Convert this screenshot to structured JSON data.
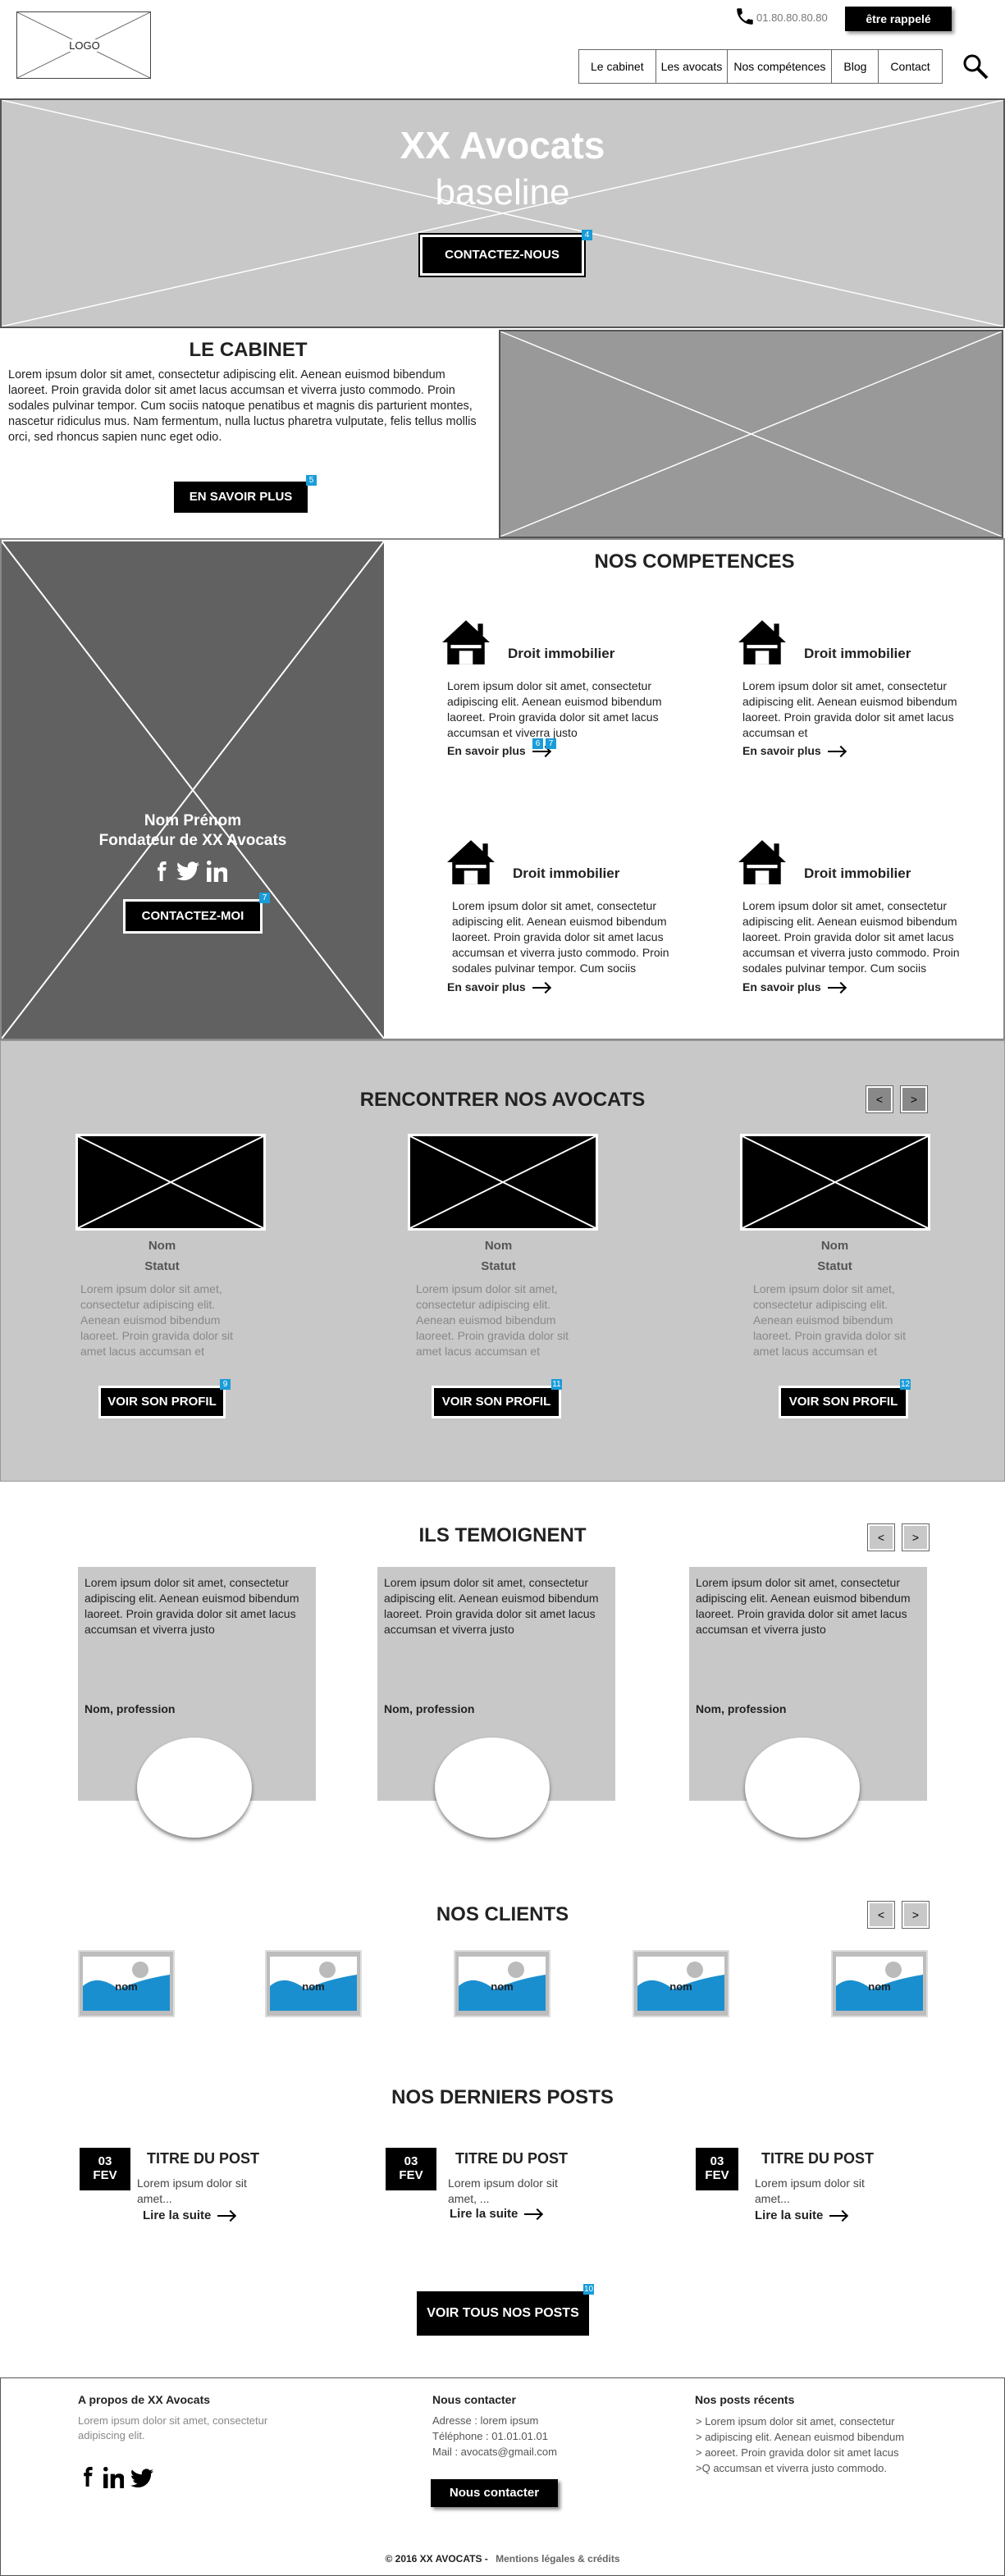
{
  "header": {
    "logo": "LOGO",
    "phone": "01.80.80.80.80",
    "callback_button": "être rappelé",
    "nav": [
      "Le cabinet",
      "Les avocats",
      "Nos compétences",
      "Blog",
      "Contact"
    ]
  },
  "hero": {
    "title": "XX Avocats",
    "baseline": "baseline",
    "cta": "CONTACTEZ-NOUS",
    "badge": "4"
  },
  "cabinet": {
    "title": "LE CABINET",
    "text": "Lorem ipsum dolor sit amet, consectetur adipiscing elit. Aenean euismod bibendum laoreet. Proin gravida dolor sit amet lacus accumsan et viverra justo commodo. Proin sodales pulvinar tempor. Cum sociis natoque penatibus et magnis dis parturient montes, nascetur ridiculus mus. Nam fermentum, nulla luctus pharetra vulputate, felis tellus mollis orci, sed rhoncus sapien nunc eget odio.",
    "button": "EN SAVOIR PLUS",
    "badge": "5"
  },
  "founder": {
    "name": "Nom Prénom",
    "role": "Fondateur de XX Avocats",
    "button": "CONTACTEZ-MOI",
    "badge": "7"
  },
  "competences": {
    "title": "NOS COMPETENCES",
    "items": [
      {
        "title": "Droit immobilier",
        "text": "Lorem ipsum dolor sit amet, consectetur adipiscing elit. Aenean euismod bibendum laoreet. Proin gravida dolor sit amet lacus accumsan et viverra justo",
        "link": "En savoir plus"
      },
      {
        "title": "Droit immobilier",
        "text": "Lorem ipsum dolor sit amet, consectetur adipiscing elit. Aenean euismod bibendum laoreet. Proin gravida dolor sit amet lacus accumsan et",
        "link": "En savoir plus"
      },
      {
        "title": "Droit immobilier",
        "text": "Lorem ipsum dolor sit amet, consectetur adipiscing elit. Aenean euismod bibendum laoreet. Proin gravida dolor sit amet lacus accumsan et viverra justo commodo. Proin sodales pulvinar tempor. Cum sociis",
        "link": "En savoir plus"
      },
      {
        "title": "Droit immobilier",
        "text": "Lorem ipsum dolor sit amet, consectetur adipiscing elit. Aenean euismod bibendum laoreet. Proin gravida dolor sit amet lacus accumsan et viverra justo commodo. Proin sodales pulvinar tempor. Cum sociis",
        "link": "En savoir plus"
      }
    ],
    "badges": [
      "6",
      "7"
    ]
  },
  "avocats": {
    "title": "RENCONTRER NOS AVOCATS",
    "prev": "<",
    "next": ">",
    "items": [
      {
        "name": "Nom",
        "status": "Statut",
        "text": "Lorem ipsum dolor sit amet, consectetur adipiscing elit. Aenean euismod bibendum laoreet. Proin gravida dolor sit amet lacus accumsan et",
        "button": "VOIR SON PROFIL",
        "badge": "9"
      },
      {
        "name": "Nom",
        "status": "Statut",
        "text": "Lorem ipsum dolor sit amet, consectetur adipiscing elit. Aenean euismod bibendum laoreet. Proin gravida dolor sit amet lacus accumsan et",
        "button": "VOIR SON PROFIL",
        "badge": "11"
      },
      {
        "name": "Nom",
        "status": "Statut",
        "text": "Lorem ipsum dolor sit amet, consectetur adipiscing elit. Aenean euismod bibendum laoreet. Proin gravida dolor sit amet lacus accumsan et",
        "button": "VOIR SON PROFIL",
        "badge": "12"
      }
    ]
  },
  "temoignages": {
    "title": "ILS TEMOIGNENT",
    "prev": "<",
    "next": ">",
    "items": [
      {
        "text": "Lorem ipsum dolor sit amet, consectetur adipiscing elit. Aenean euismod bibendum laoreet. Proin gravida dolor sit amet lacus accumsan et viverra justo",
        "author": "Nom, profession"
      },
      {
        "text": "Lorem ipsum dolor sit amet, consectetur adipiscing elit. Aenean euismod bibendum laoreet. Proin gravida dolor sit amet lacus accumsan et viverra justo",
        "author": "Nom, profession"
      },
      {
        "text": "Lorem ipsum dolor sit amet, consectetur adipiscing elit. Aenean euismod bibendum laoreet. Proin gravida dolor sit amet lacus accumsan et viverra justo",
        "author": "Nom, profession"
      }
    ]
  },
  "clients": {
    "title": "NOS CLIENTS",
    "prev": "<",
    "next": ">",
    "items": [
      "nom",
      "nom",
      "nom",
      "nom",
      "nom"
    ]
  },
  "posts": {
    "title": "NOS DERNIERS POSTS",
    "items": [
      {
        "day": "03",
        "month": "FEV",
        "title": "TITRE DU POST",
        "text": "Lorem ipsum dolor sit amet...",
        "link": "Lire la suite"
      },
      {
        "day": "03",
        "month": "FEV",
        "title": "TITRE DU POST",
        "text": "Lorem ipsum dolor sit amet, ...",
        "link": "Lire la suite"
      },
      {
        "day": "03",
        "month": "FEV",
        "title": "TITRE DU POST",
        "text": "Lorem ipsum dolor sit amet...",
        "link": "Lire la suite"
      }
    ],
    "all_button": "VOIR TOUS NOS POSTS",
    "badge": "10"
  },
  "footer": {
    "about_title": "A propos de XX Avocats",
    "about_text": "Lorem ipsum dolor sit amet, consectetur adipiscing elit.",
    "contact_title": "Nous contacter",
    "address": "Adresse : lorem ipsum",
    "phone": "Téléphone : 01.01.01.01",
    "mail": "Mail : avocats@gmail.com",
    "contact_button": "Nous contacter",
    "posts_title": "Nos posts récents",
    "posts": [
      "> Lorem ipsum dolor sit amet, consectetur",
      "> adipiscing elit. Aenean euismod bibendum",
      "> aoreet. Proin gravida dolor sit amet lacus",
      ">Q accumsan et viverra justo commodo."
    ],
    "copyright": "© 2016 XX AVOCATS -",
    "legal": "Mentions légales & crédits"
  },
  "colors": {
    "badge": "#1a9cd8",
    "hero_bg": "#c8c8c8",
    "founder_bg": "#616161",
    "client_blue": "#1a8fd0"
  }
}
